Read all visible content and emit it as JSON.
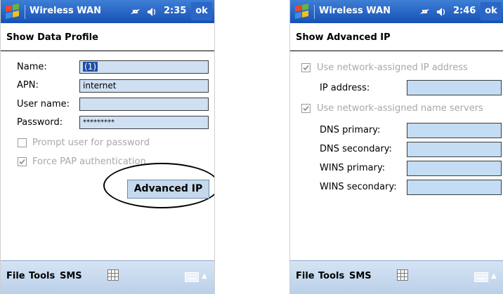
{
  "left": {
    "title": "Wireless WAN",
    "time": "2:35",
    "ok": "ok",
    "header": "Show Data Profile",
    "fields": [
      {
        "label": "Name:",
        "value": "(1)"
      },
      {
        "label": "APN:",
        "value": "internet"
      },
      {
        "label": "User name:",
        "value": ""
      },
      {
        "label": "Password:",
        "value": "*********"
      }
    ],
    "prompt_checkbox": {
      "label": "Prompt user for password",
      "checked": false
    },
    "pap_checkbox": {
      "label": "Force PAP authentication",
      "checked": true
    },
    "advanced_button": "Advanced IP",
    "menu": [
      "File",
      "Tools",
      "SMS"
    ]
  },
  "right": {
    "title": "Wireless WAN",
    "time": "2:46",
    "ok": "ok",
    "header": "Show Advanced IP",
    "ip_checkbox": {
      "label": "Use network-assigned IP address",
      "checked": true
    },
    "ip_label": "IP address:",
    "ns_checkbox": {
      "label": "Use network-assigned name servers",
      "checked": true
    },
    "dns_fields": [
      {
        "label": "DNS primary:"
      },
      {
        "label": "DNS secondary:"
      },
      {
        "label": "WINS primary:"
      },
      {
        "label": "WINS secondary:"
      }
    ],
    "menu": [
      "File",
      "Tools",
      "SMS"
    ]
  },
  "colors": {
    "titlebar": "#1650b4",
    "field": "#cfe0f3",
    "bottombar": "#c6d9ee",
    "disabled_text": "#a8a8a8"
  },
  "icons": [
    "windows-start-icon",
    "connectivity-icon",
    "volume-icon",
    "sip-grid-icon",
    "keyboard-icon"
  ]
}
